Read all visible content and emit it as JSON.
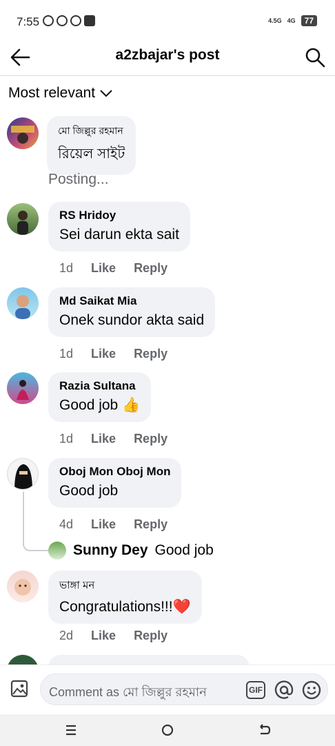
{
  "status": {
    "time": "7:55",
    "network1": "4.5G",
    "network2": "4G",
    "battery": "77"
  },
  "header": {
    "title": "a2zbajar's post"
  },
  "filter": {
    "label": "Most relevant"
  },
  "pending": {
    "name": "মো জিল্লুর রহমান",
    "text": "রিয়েল সাইট",
    "status": "Posting..."
  },
  "comments": [
    {
      "name": "RS Hridoy",
      "text": "Sei darun ekta sait",
      "age": "1d",
      "like": "Like",
      "reply": "Reply"
    },
    {
      "name": "Md Saikat Mia",
      "text": "Onek sundor akta said",
      "age": "1d",
      "like": "Like",
      "reply": "Reply"
    },
    {
      "name": "Razia Sultana",
      "text": "Good job 👍",
      "age": "1d",
      "like": "Like",
      "reply": "Reply"
    },
    {
      "name": "Oboj Mon Oboj Mon",
      "text": "Good job",
      "age": "4d",
      "like": "Like",
      "reply": "Reply"
    },
    {
      "name": "ভাঙ্গা মন",
      "text": "Congratulations!!!❤️",
      "age": "2d",
      "like": "Like",
      "reply": "Reply"
    }
  ],
  "reply_preview": {
    "name": "Sunny Dey",
    "text": "Good job"
  },
  "composer": {
    "placeholder": "Comment as মো জিল্লুর রহমান",
    "gif_label": "GIF"
  },
  "colors": {
    "bubble": "#f0f2f5",
    "meta": "#65676b",
    "heart": "#e0245e"
  }
}
